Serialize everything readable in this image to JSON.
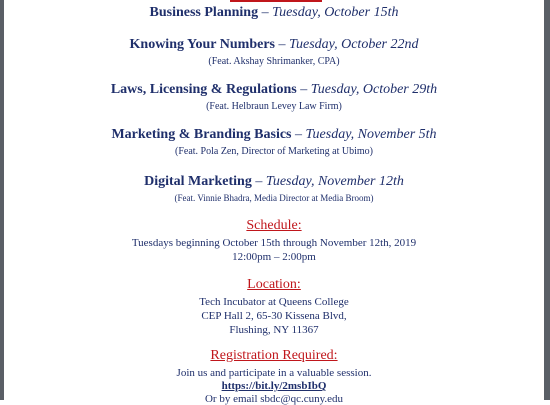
{
  "sessions": [
    {
      "title": "Business Planning",
      "date": "Tuesday, October 15th",
      "feat": ""
    },
    {
      "title": "Knowing Your Numbers",
      "date": "Tuesday, October 22nd",
      "feat": "(Feat. Akshay Shrimanker, CPA)"
    },
    {
      "title": "Laws, Licensing & Regulations",
      "date": "Tuesday, October 29th",
      "feat": "(Feat. Helbraun Levey Law Firm)"
    },
    {
      "title": "Marketing & Branding Basics",
      "date": "Tuesday, November 5th",
      "feat": "(Feat. Pola Zen, Director of Marketing at Ubimo)"
    },
    {
      "title": "Digital Marketing",
      "date": "Tuesday, November 12th",
      "feat": "(Feat. Vinnie Bhadra, Media Director at Media Broom)"
    }
  ],
  "dash": " – ",
  "schedule": {
    "heading": "Schedule:",
    "line1": "Tuesdays beginning October 15th through November 12th, 2019",
    "line2": "12:00pm – 2:00pm"
  },
  "location": {
    "heading": "Location:",
    "line1": "Tech Incubator at Queens College",
    "line2": "CEP Hall 2, 65-30 Kissena Blvd,",
    "line3": "Flushing, NY 11367"
  },
  "registration": {
    "heading": "Registration Required:",
    "line1": "Join us and participate in a valuable session.",
    "link": "https://bit.ly/2msbIbQ",
    "line3": "Or by email sbdc@qc.cuny.edu"
  },
  "colors": {
    "navy": "#1f2f6b",
    "red": "#c0161b",
    "frame": "#5a5f66"
  }
}
